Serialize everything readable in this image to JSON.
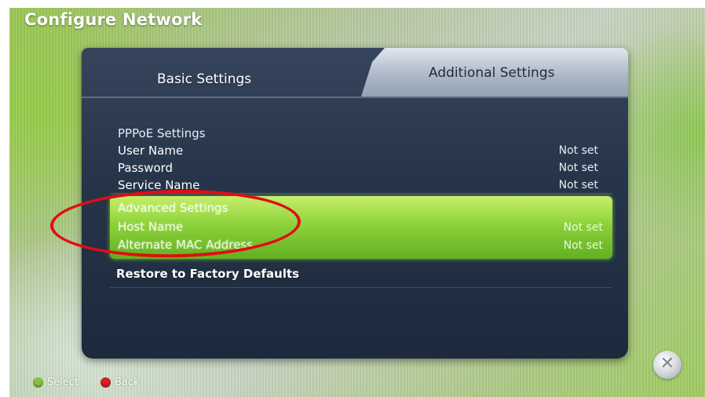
{
  "header": {
    "title": "Configure Network"
  },
  "tabs": [
    {
      "label": "Basic Settings",
      "active": false
    },
    {
      "label": "Additional Settings",
      "active": true
    }
  ],
  "pppoe": {
    "heading": "PPPoE Settings",
    "items": [
      {
        "label": "User Name",
        "value": "Not set"
      },
      {
        "label": "Password",
        "value": "Not set"
      },
      {
        "label": "Service Name",
        "value": "Not set"
      }
    ]
  },
  "advanced": {
    "heading": "Advanced Settings",
    "items": [
      {
        "label": "Host Name",
        "value": "Not set"
      },
      {
        "label": "Alternate MAC Address",
        "value": "Not set"
      }
    ]
  },
  "restore": {
    "label": "Restore to Factory Defaults"
  },
  "footer": {
    "select": {
      "label": "Select",
      "color": "#8ac43f"
    },
    "back": {
      "label": "Back",
      "color": "#d5212a"
    }
  },
  "annotation": {
    "color": "#e10c14"
  },
  "colors": {
    "highlight": "#8dd23a",
    "panel": "#253448"
  }
}
